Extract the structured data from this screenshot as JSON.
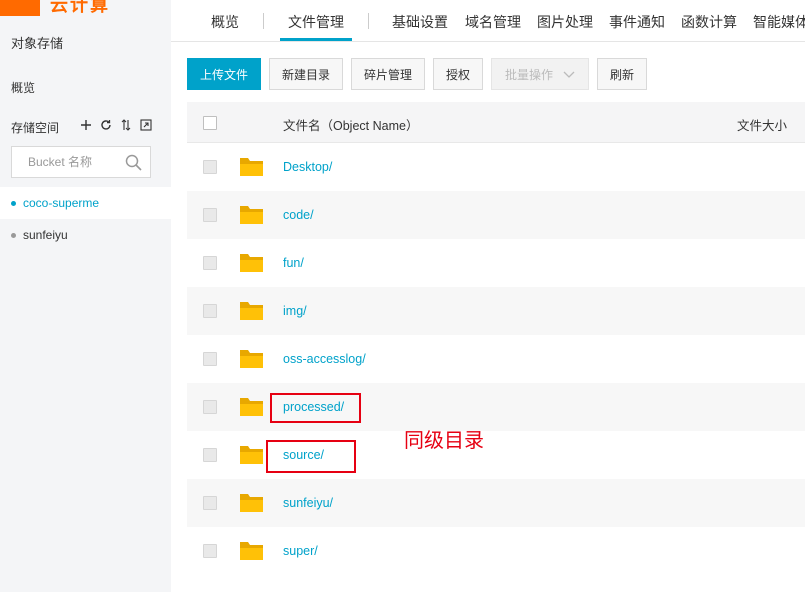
{
  "logo": {
    "text": "云计算"
  },
  "sidebar": {
    "title": "对象存储",
    "overview": "概览",
    "bucket_header": "存储空间",
    "search_placeholder": "Bucket 名称",
    "buckets": [
      {
        "name": "coco-superme",
        "active": true
      },
      {
        "name": "sunfeiyu",
        "active": false
      }
    ]
  },
  "tabs": [
    {
      "label": "概览"
    },
    {
      "label": "文件管理",
      "active": true
    },
    {
      "label": "基础设置"
    },
    {
      "label": "域名管理"
    },
    {
      "label": "图片处理"
    },
    {
      "label": "事件通知"
    },
    {
      "label": "函数计算"
    },
    {
      "label": "智能媒体"
    }
  ],
  "toolbar": {
    "upload": "上传文件",
    "new_dir": "新建目录",
    "fragments": "碎片管理",
    "authorize": "授权",
    "batch": "批量操作",
    "refresh": "刷新"
  },
  "table": {
    "col_name": "文件名（Object Name）",
    "col_size": "文件大小",
    "rows": [
      "Desktop/",
      "code/",
      "fun/",
      "img/",
      "oss-accesslog/",
      "processed/",
      "source/",
      "sunfeiyu/",
      "super/"
    ]
  },
  "annotation": "同级目录",
  "colors": {
    "accent": "#00a2ca",
    "brand": "#ff6a00",
    "highlight": "#e60012",
    "folder": "#ffc107"
  }
}
